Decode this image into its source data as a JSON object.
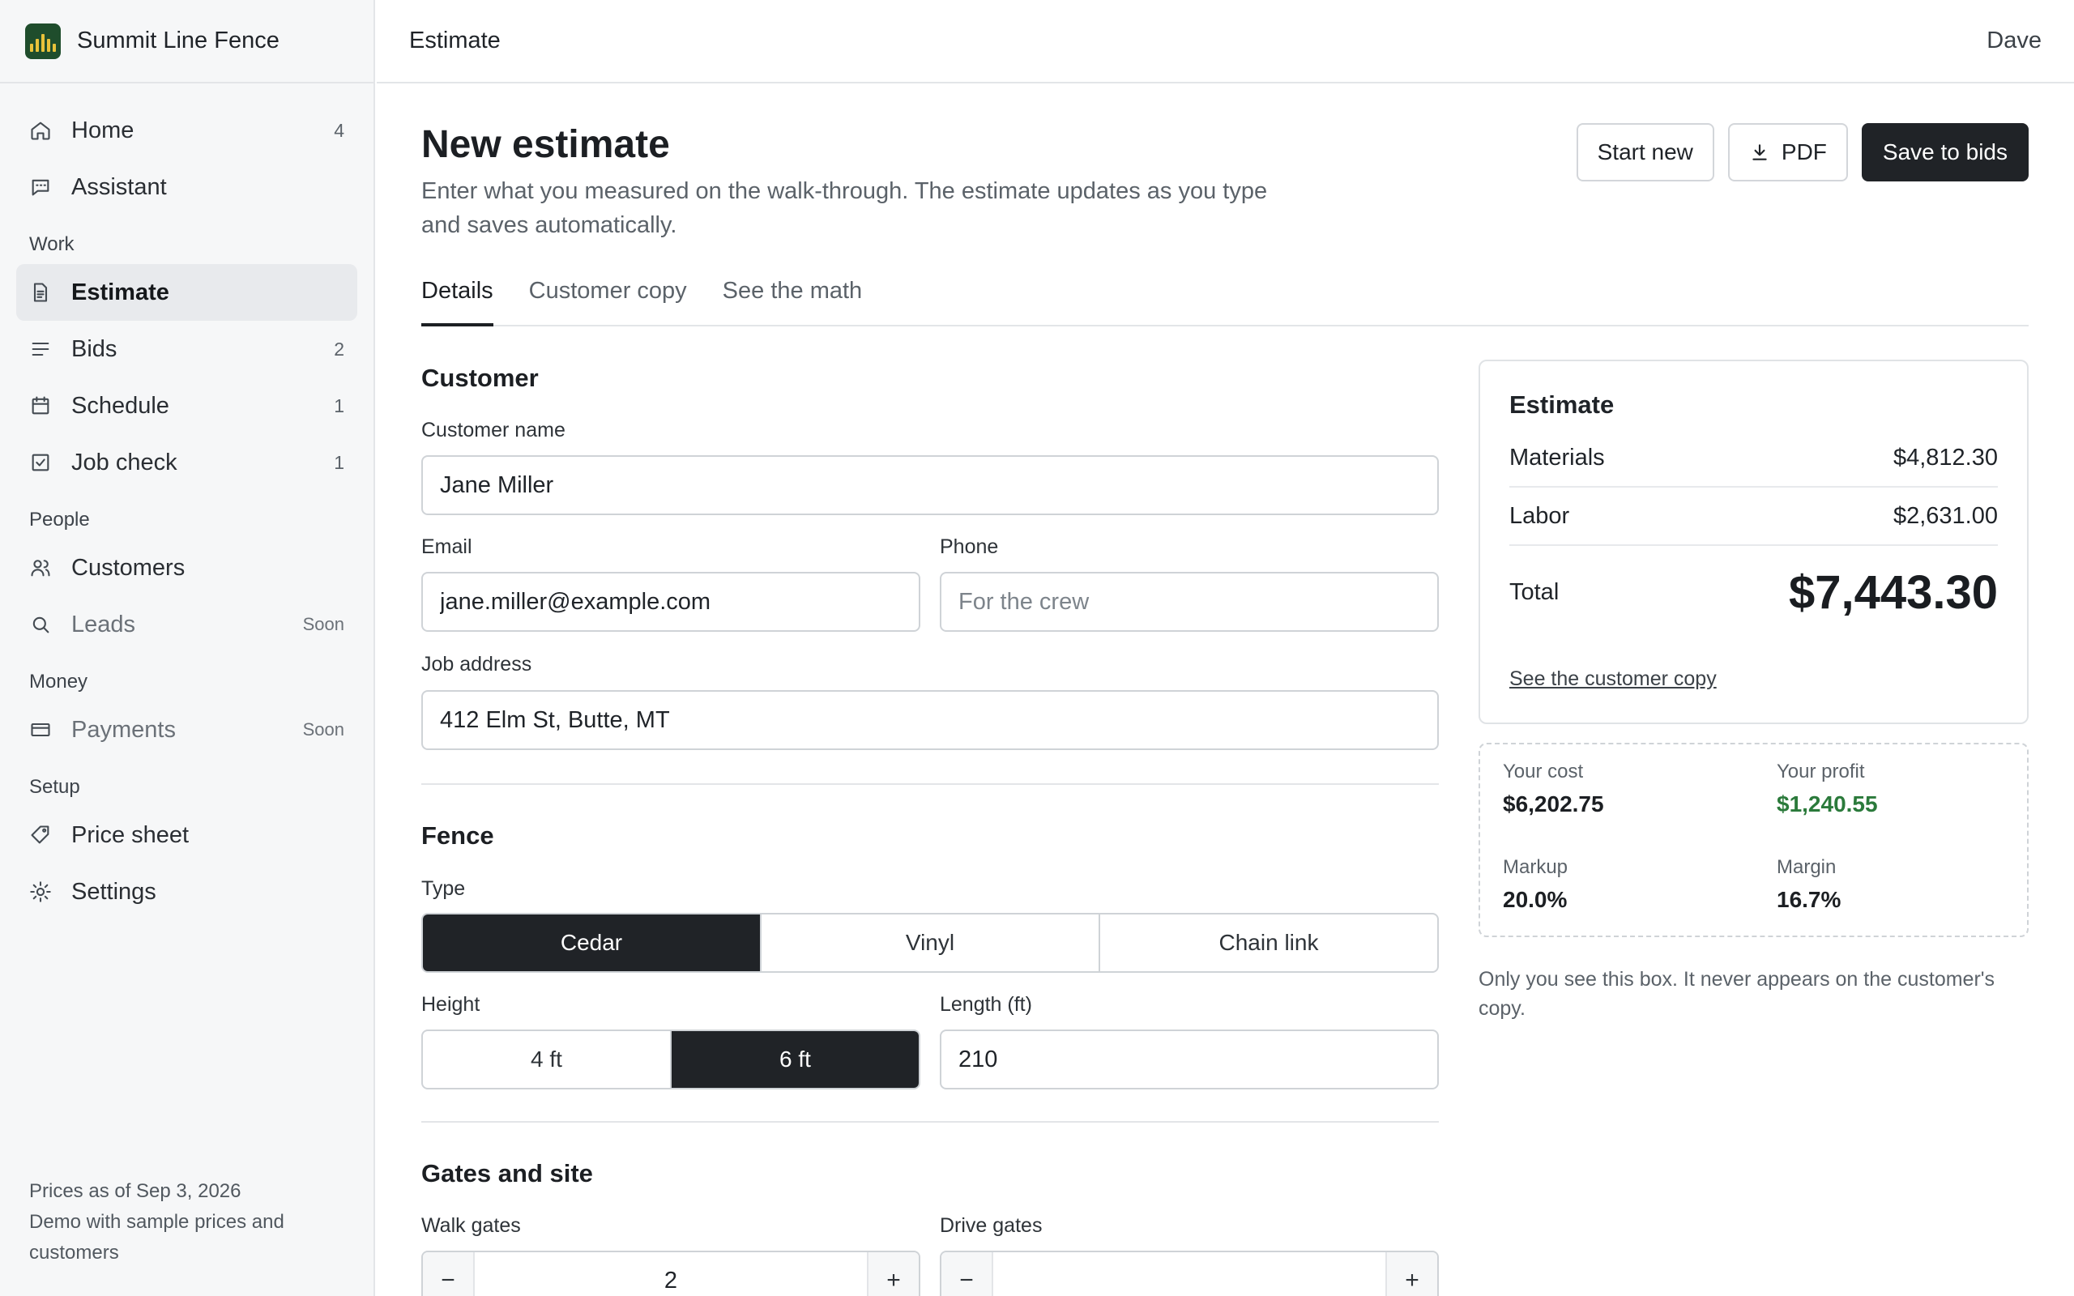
{
  "brand": {
    "name": "Summit Line Fence"
  },
  "topbar": {
    "title": "Estimate",
    "user": "Dave"
  },
  "sidebar": {
    "items": [
      {
        "label": "Home",
        "count": "4",
        "icon": "home-icon"
      },
      {
        "label": "Assistant",
        "count": "",
        "icon": "chat-icon"
      }
    ],
    "sections": [
      {
        "title": "Work",
        "items": [
          {
            "label": "Estimate",
            "count": "",
            "icon": "document-icon",
            "active": true
          },
          {
            "label": "Bids",
            "count": "2",
            "icon": "lines-icon"
          },
          {
            "label": "Schedule",
            "count": "1",
            "icon": "calendar-icon"
          },
          {
            "label": "Job check",
            "count": "1",
            "icon": "checkbox-icon"
          }
        ]
      },
      {
        "title": "People",
        "items": [
          {
            "label": "Customers",
            "count": "",
            "icon": "users-icon"
          },
          {
            "label": "Leads",
            "soon": "Soon",
            "icon": "search-icon"
          }
        ]
      },
      {
        "title": "Money",
        "items": [
          {
            "label": "Payments",
            "soon": "Soon",
            "icon": "card-icon"
          }
        ]
      },
      {
        "title": "Setup",
        "items": [
          {
            "label": "Price sheet",
            "count": "",
            "icon": "tag-icon"
          },
          {
            "label": "Settings",
            "count": "",
            "icon": "gear-icon"
          }
        ]
      }
    ],
    "footer": {
      "prices": "Prices as of Sep 3, 2026",
      "demo": "Demo with sample prices and customers"
    }
  },
  "header": {
    "title": "New estimate",
    "subtitle": "Enter what you measured on the walk-through. The estimate updates as you type and saves automatically.",
    "actions": {
      "start_new": "Start new",
      "pdf": "PDF",
      "save": "Save to bids"
    }
  },
  "tabs": [
    {
      "label": "Details",
      "active": true
    },
    {
      "label": "Customer copy"
    },
    {
      "label": "See the math"
    }
  ],
  "customer": {
    "section": "Customer",
    "name_label": "Customer name",
    "name_value": "Jane Miller",
    "email_label": "Email",
    "email_value": "jane.miller@example.com",
    "phone_label": "Phone",
    "phone_placeholder": "For the crew",
    "address_label": "Job address",
    "address_value": "412 Elm St, Butte, MT"
  },
  "fence": {
    "section": "Fence",
    "type_label": "Type",
    "types": [
      "Cedar",
      "Vinyl",
      "Chain link"
    ],
    "type_selected": "Cedar",
    "height_label": "Height",
    "heights": [
      "4 ft",
      "6 ft"
    ],
    "height_selected": "6 ft",
    "length_label": "Length (ft)",
    "length_value": "210"
  },
  "gates": {
    "section": "Gates and site",
    "walk_label": "Walk gates",
    "walk_value": "2",
    "drive_label": "Drive gates",
    "drive_value": "",
    "minus": "−",
    "plus": "+"
  },
  "estimate": {
    "title": "Estimate",
    "materials_label": "Materials",
    "materials_value": "$4,812.30",
    "labor_label": "Labor",
    "labor_value": "$2,631.00",
    "total_label": "Total",
    "total_value": "$7,443.30",
    "link": "See the customer copy"
  },
  "private": {
    "cost_label": "Your cost",
    "cost_value": "$6,202.75",
    "profit_label": "Your profit",
    "profit_value": "$1,240.55",
    "markup_label": "Markup",
    "markup_value": "20.0%",
    "margin_label": "Margin",
    "margin_value": "16.7%",
    "note": "Only you see this box. It never appears on the customer's copy."
  },
  "colors": {
    "primary": "#202327",
    "profit": "#2b7a3b",
    "brand": "#1f4d2c",
    "brand_accent": "#e8c23a"
  }
}
